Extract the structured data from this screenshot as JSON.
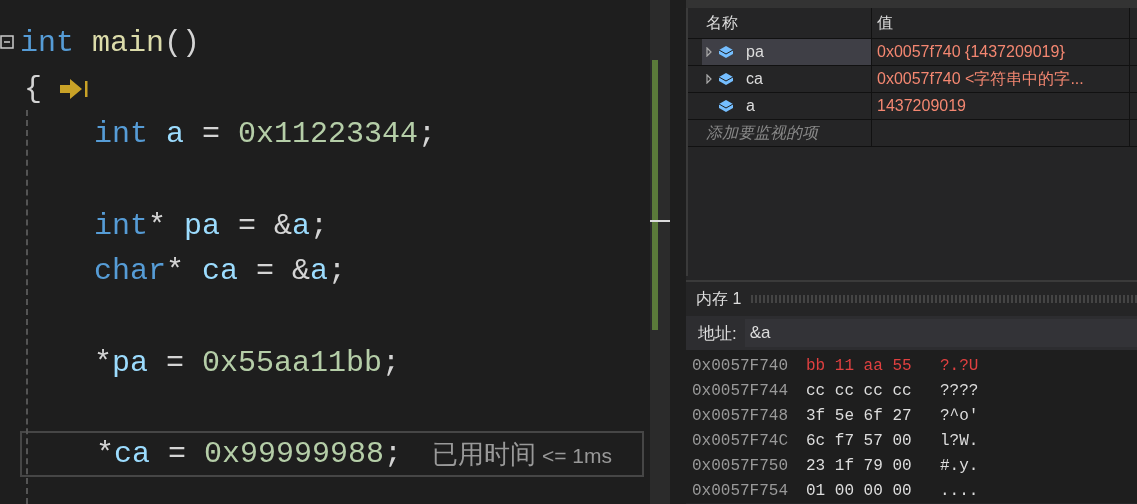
{
  "editor": {
    "lines": [
      {
        "kind": "head",
        "fold": true,
        "tokens": [
          {
            "text": "int",
            "kind": "keyword"
          },
          {
            "text": " main",
            "kind": "func"
          },
          {
            "text": "()",
            "kind": "plain"
          }
        ]
      },
      {
        "kind": "brace",
        "step": true,
        "tokens": [
          {
            "text": "{",
            "kind": "plain"
          }
        ]
      },
      {
        "kind": "body",
        "tokens": [
          {
            "text": "int",
            "kind": "keyword"
          },
          {
            "text": " a",
            "kind": "ident"
          },
          {
            "text": " = ",
            "kind": "plain"
          },
          {
            "text": "0x11223344",
            "kind": "number"
          },
          {
            "text": ";",
            "kind": "plain"
          }
        ]
      },
      {
        "kind": "blank"
      },
      {
        "kind": "body",
        "tokens": [
          {
            "text": "int",
            "kind": "keyword"
          },
          {
            "text": "* ",
            "kind": "plain"
          },
          {
            "text": "pa",
            "kind": "ident"
          },
          {
            "text": " = &",
            "kind": "plain"
          },
          {
            "text": "a",
            "kind": "ident"
          },
          {
            "text": ";",
            "kind": "plain"
          }
        ]
      },
      {
        "kind": "body",
        "tokens": [
          {
            "text": "char",
            "kind": "keyword"
          },
          {
            "text": "* ",
            "kind": "plain"
          },
          {
            "text": "ca",
            "kind": "ident"
          },
          {
            "text": " = &",
            "kind": "plain"
          },
          {
            "text": "a",
            "kind": "ident"
          },
          {
            "text": ";",
            "kind": "plain"
          }
        ]
      },
      {
        "kind": "blank"
      },
      {
        "kind": "body",
        "tokens": [
          {
            "text": "*",
            "kind": "plain"
          },
          {
            "text": "pa",
            "kind": "ident"
          },
          {
            "text": " = ",
            "kind": "plain"
          },
          {
            "text": "0x55aa11bb",
            "kind": "number"
          },
          {
            "text": ";",
            "kind": "plain"
          }
        ]
      },
      {
        "kind": "blank"
      },
      {
        "kind": "body",
        "current": true,
        "elapsed": {
          "label": "已用时间",
          "value": "<= 1ms"
        },
        "tokens": [
          {
            "text": "*",
            "kind": "plain"
          },
          {
            "text": "ca",
            "kind": "ident"
          },
          {
            "text": " = ",
            "kind": "plain"
          },
          {
            "text": "0x99999988",
            "kind": "number"
          },
          {
            "text": ";",
            "kind": "plain"
          }
        ]
      }
    ]
  },
  "watch": {
    "columns": [
      "名称",
      "值"
    ],
    "rows": [
      {
        "name": "pa",
        "value": "0x0057f740 {1437209019}",
        "expandable": true,
        "selected": true
      },
      {
        "name": "ca",
        "value": "0x0057f740  <字符串中的字...",
        "expandable": true,
        "selected": false
      },
      {
        "name": "a",
        "value": "1437209019",
        "expandable": false,
        "selected": false
      }
    ],
    "add_placeholder": "添加要监视的项"
  },
  "memory": {
    "title": "内存 1",
    "address_label": "地址:",
    "address": "&a",
    "rows": [
      {
        "address": "0x0057F740",
        "bytes": "bb 11 aa 55",
        "ascii": "?.?U",
        "changed": true
      },
      {
        "address": "0x0057F744",
        "bytes": "cc cc cc cc",
        "ascii": "????",
        "changed": false
      },
      {
        "address": "0x0057F748",
        "bytes": "3f 5e 6f 27",
        "ascii": "?^o'",
        "changed": false
      },
      {
        "address": "0x0057F74C",
        "bytes": "6c f7 57 00",
        "ascii": "l?W.",
        "changed": false
      },
      {
        "address": "0x0057F750",
        "bytes": "23 1f 79 00",
        "ascii": "#.y.",
        "changed": false
      },
      {
        "address": "0x0057F754",
        "bytes": "01 00 00 00",
        "ascii": "....",
        "changed": false
      }
    ]
  }
}
